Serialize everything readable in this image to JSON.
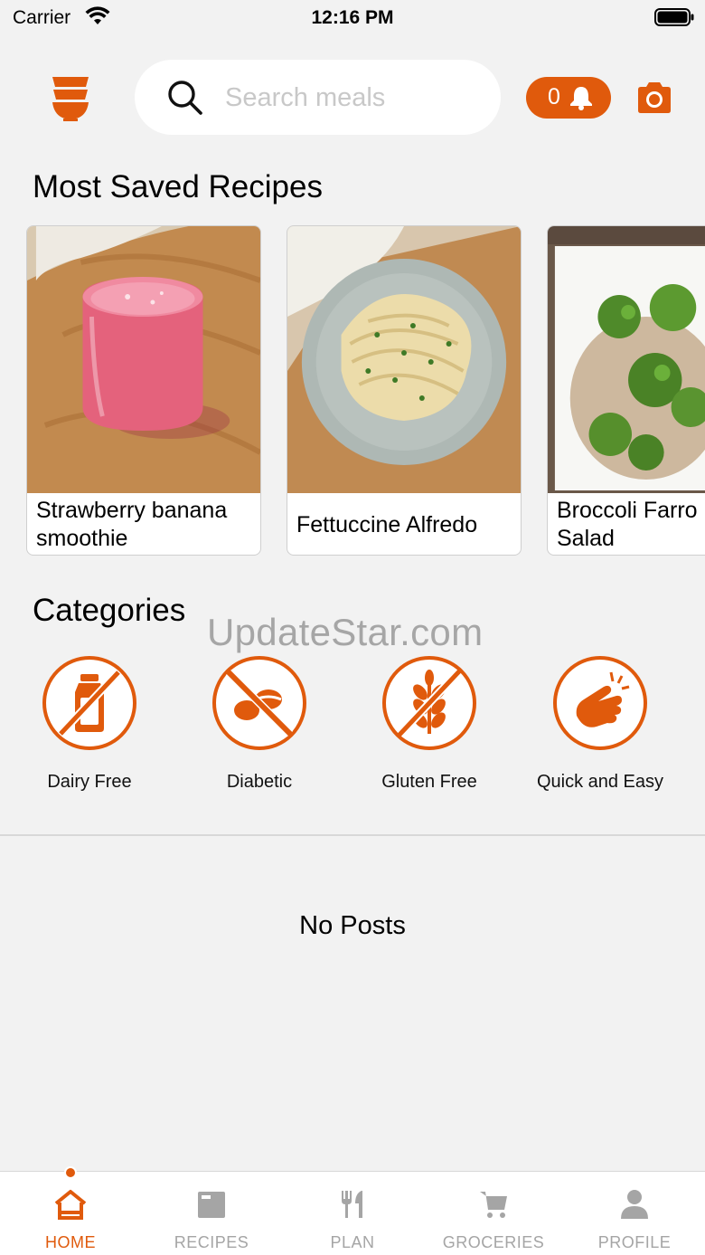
{
  "status_bar": {
    "carrier": "Carrier",
    "time": "12:16 PM"
  },
  "header": {
    "logo_icon": "bowl-stack-icon",
    "search_placeholder": "Search meals",
    "notification_count": "0",
    "camera_icon": "camera-icon"
  },
  "sections": {
    "most_saved": "Most Saved Recipes",
    "categories": "Categories"
  },
  "recipes": [
    {
      "name": "Strawberry banana smoothie"
    },
    {
      "name": "Fettuccine Alfredo"
    },
    {
      "name": "Broccoli Farro Salad"
    }
  ],
  "watermark": "UpdateStar.com",
  "categories": [
    {
      "label": "Dairy Free",
      "icon": "no-milk-icon"
    },
    {
      "label": "Diabetic",
      "icon": "no-sugar-icon"
    },
    {
      "label": "Gluten Free",
      "icon": "no-wheat-icon"
    },
    {
      "label": "Quick and Easy",
      "icon": "finger-snap-icon"
    }
  ],
  "feed": {
    "empty_message": "No Posts"
  },
  "tabs": [
    {
      "label": "HOME",
      "icon": "home-icon",
      "active": true
    },
    {
      "label": "RECIPES",
      "icon": "folder-icon"
    },
    {
      "label": "PLAN",
      "icon": "fork-knife-icon"
    },
    {
      "label": "GROCERIES",
      "icon": "cart-icon"
    },
    {
      "label": "PROFILE",
      "icon": "person-icon"
    }
  ],
  "colors": {
    "accent": "#e05a0c",
    "background": "#f2f2f2",
    "tab_inactive": "#a5a5a5"
  }
}
